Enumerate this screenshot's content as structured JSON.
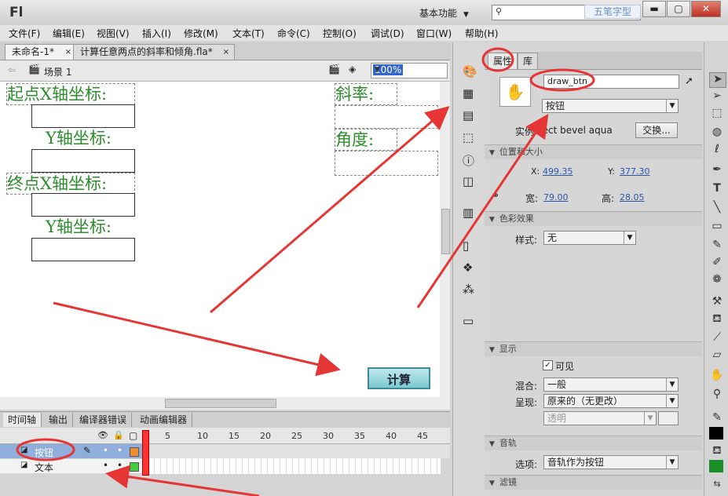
{
  "title_bar": {
    "logo": "Fl",
    "workspace": "基本功能",
    "watermark": "五笔字型"
  },
  "menu": [
    "文件(F)",
    "编辑(E)",
    "视图(V)",
    "插入(I)",
    "修改(M)",
    "文本(T)",
    "命令(C)",
    "控制(O)",
    "调试(D)",
    "窗口(W)",
    "帮助(H)"
  ],
  "doc_tabs": [
    {
      "label": "未命名-1*",
      "close": "×"
    },
    {
      "label": "计算任意两点的斜率和倾角.fla*",
      "close": "×"
    }
  ],
  "scene": {
    "label": "场景 1",
    "zoom": "100%"
  },
  "stage": {
    "start_x_label": "起点X轴坐标:",
    "start_y_label": "Y轴坐标:",
    "end_x_label": "终点X轴坐标:",
    "end_y_label": "Y轴坐标:",
    "slope_label": "斜率:",
    "angle_label": "角度:",
    "calc_button": "计算"
  },
  "properties": {
    "tab_props": "属性",
    "tab_library": "库",
    "instance_name": "draw_btn",
    "symbol_type": "按钮",
    "instance_of_label": "实例",
    "instance_of_value": "rect bevel aqua",
    "swap_button": "交换...",
    "section_position": "位置和大小",
    "x_label": "X:",
    "x_value": "499.35",
    "y_label": "Y:",
    "y_value": "377.30",
    "w_label": "宽:",
    "w_value": "79.00",
    "h_label": "高:",
    "h_value": "28.05",
    "section_color": "色彩效果",
    "style_label": "样式:",
    "style_value": "无",
    "section_display": "显示",
    "visible_label": "可见",
    "blend_label": "混合:",
    "blend_value": "一般",
    "render_label": "呈现:",
    "render_value": "原来的（无更改）",
    "transparent_value": "透明",
    "section_track": "音轨",
    "options_label": "选项:",
    "options_value": "音轨作为按钮",
    "section_filters": "滤镜"
  },
  "timeline": {
    "tabs": [
      "时间轴",
      "输出",
      "编译器错误",
      "动画编辑器"
    ],
    "frame_numbers": [
      "1",
      "5",
      "10",
      "15",
      "20",
      "25",
      "30",
      "35",
      "40",
      "45"
    ],
    "layers": [
      {
        "name": "按钮",
        "color": "#f08a2a"
      },
      {
        "name": "文本",
        "color": "#44cc44"
      }
    ]
  },
  "colors": {
    "accent_red": "#e53535",
    "label_green": "#2d8d2d",
    "selection_blue": "#3366cc"
  }
}
